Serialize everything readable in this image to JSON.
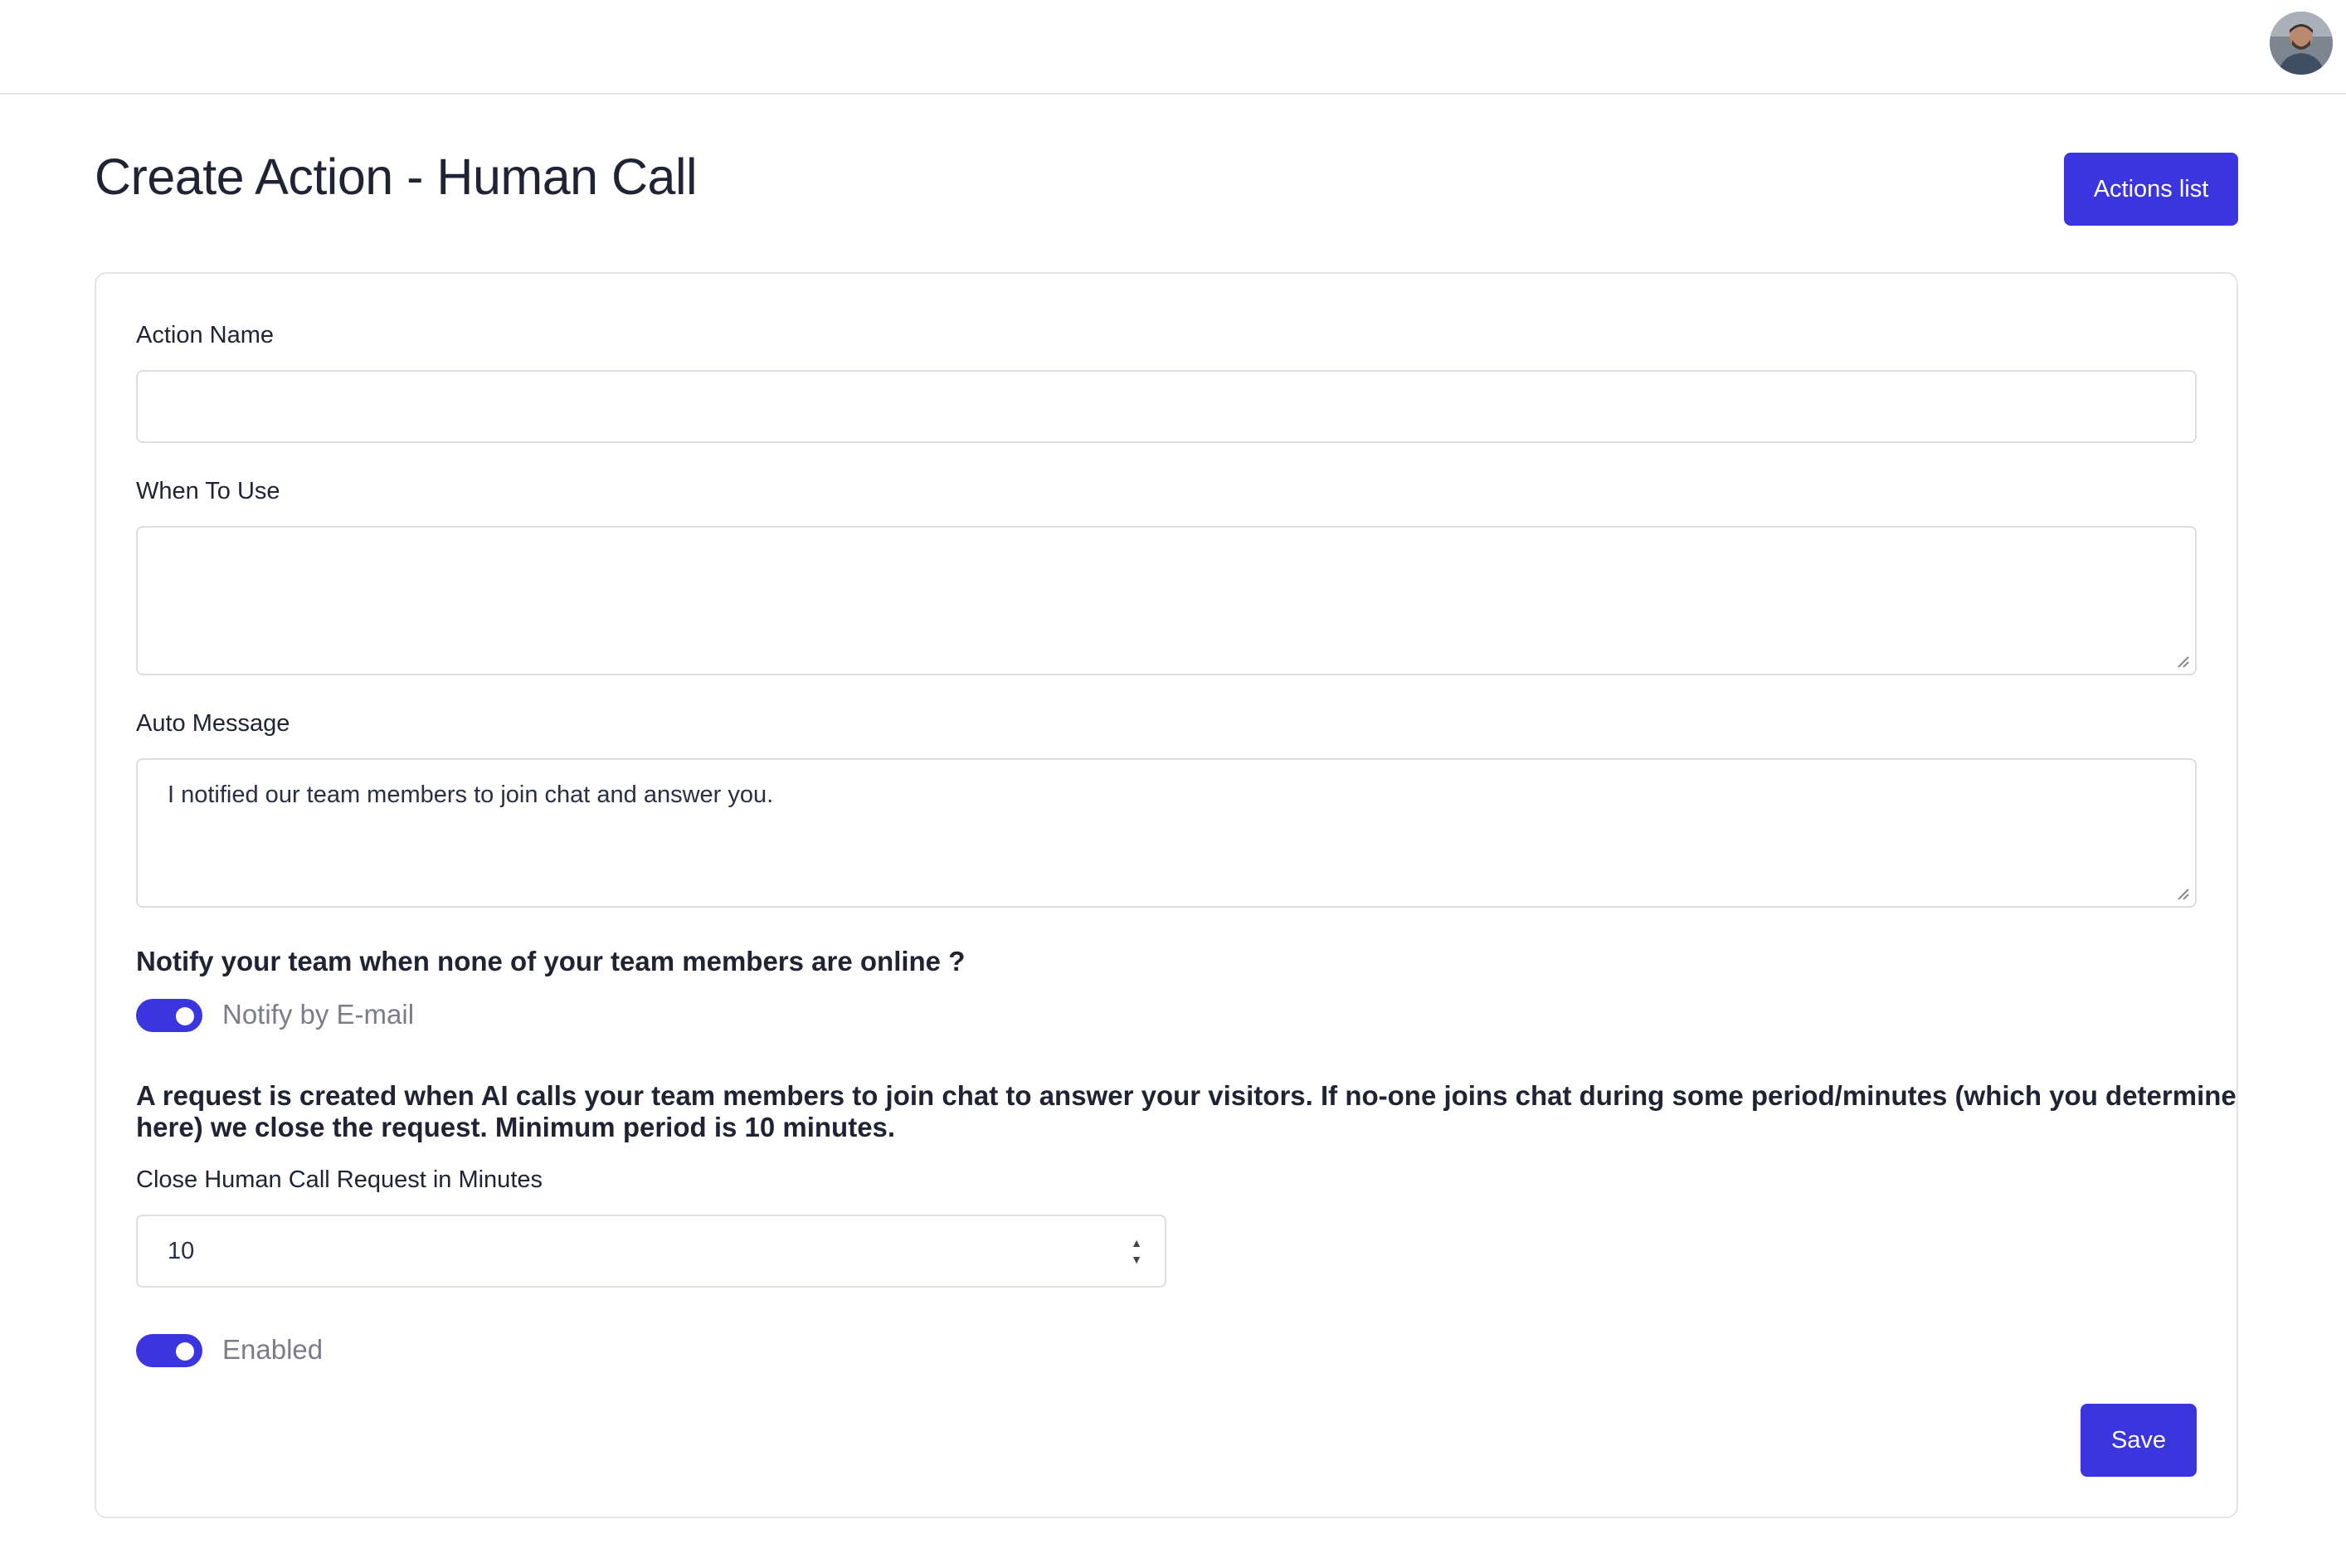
{
  "header": {
    "avatar_alt": "user avatar"
  },
  "page": {
    "title": "Create Action - Human Call",
    "actions_list_label": "Actions list"
  },
  "form": {
    "action_name": {
      "label": "Action Name",
      "value": ""
    },
    "when_to_use": {
      "label": "When To Use",
      "value": ""
    },
    "auto_message": {
      "label": "Auto Message",
      "value": "I notified our team members to join chat and answer you."
    },
    "notify_heading": "Notify your team when none of your team members are online ?",
    "notify_email": {
      "label": "Notify by E-mail",
      "checked": true
    },
    "request_info_line1": "A request is created when AI calls your team members to join chat to answer your visitors. If no-one joins chat during some period/minutes (which you determine",
    "request_info_line2": "here) we close the request. Minimum period is 10 minutes.",
    "close_minutes": {
      "label": "Close Human Call Request in Minutes",
      "value": "10"
    },
    "enabled": {
      "label": "Enabled",
      "checked": true
    },
    "save_label": "Save"
  },
  "colors": {
    "accent": "#3b35e0",
    "border": "#dcdee3",
    "text": "#1f2333",
    "muted": "#7a7d86"
  }
}
